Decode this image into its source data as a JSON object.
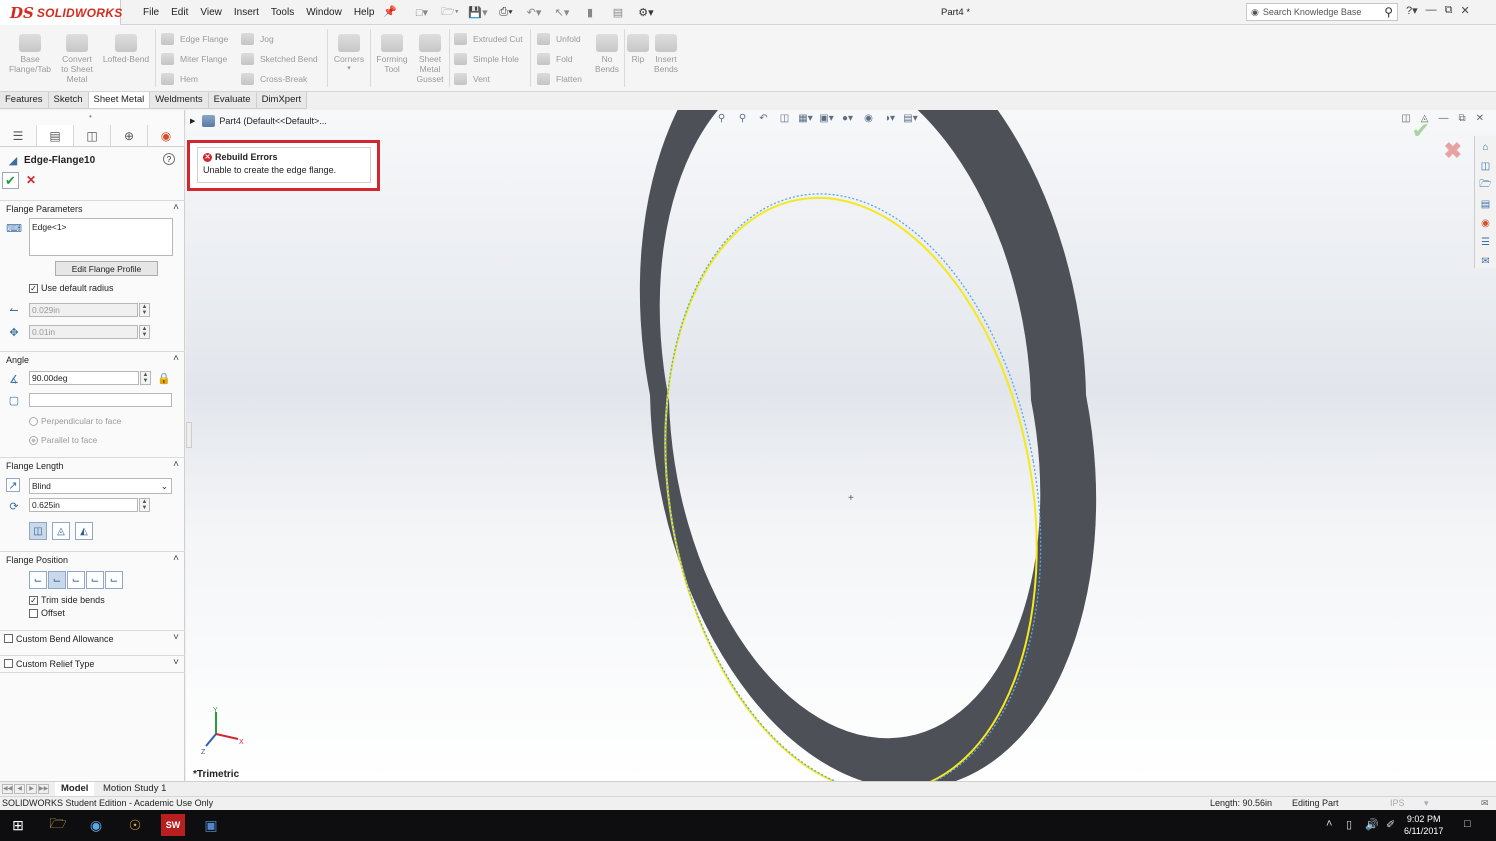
{
  "app": {
    "logo_ds": "DS",
    "logo_text": "SOLIDWORKS",
    "document_title": "Part4 *",
    "menu": [
      "File",
      "Edit",
      "View",
      "Insert",
      "Tools",
      "Window",
      "Help"
    ],
    "search_placeholder": "Search Knowledge Base"
  },
  "command_manager": {
    "big_buttons": [
      "Base Flange/Tab",
      "Convert to Sheet Metal",
      "Lofted-Bend",
      "Corners",
      "Forming Tool",
      "Sheet Metal Gusset",
      "No Bends",
      "Rip",
      "Insert Bends"
    ],
    "small_buttons": [
      "Edge Flange",
      "Miter Flange",
      "Hem",
      "Jog",
      "Sketched Bend",
      "Cross-Break",
      "Extruded Cut",
      "Simple Hole",
      "Vent",
      "Unfold",
      "Fold",
      "Flatten"
    ]
  },
  "tabs": [
    {
      "label": "Features",
      "active": false
    },
    {
      "label": "Sketch",
      "active": false
    },
    {
      "label": "Sheet Metal",
      "active": true
    },
    {
      "label": "Weldments",
      "active": false
    },
    {
      "label": "Evaluate",
      "active": false
    },
    {
      "label": "DimXpert",
      "active": false
    }
  ],
  "property_manager": {
    "title": "Edge-Flange10",
    "flange_parameters": {
      "header": "Flange Parameters",
      "selection": "Edge<1>",
      "edit_profile_button": "Edit Flange Profile",
      "use_default_radius_label": "Use default radius",
      "use_default_radius_checked": true,
      "bend_radius": "0.029in",
      "gap_distance": "0.01in"
    },
    "angle": {
      "header": "Angle",
      "value": "90.00deg",
      "reference_face": "",
      "perpendicular_label": "Perpendicular to face",
      "parallel_label": "Parallel to face"
    },
    "flange_length": {
      "header": "Flange Length",
      "end_condition": "Blind",
      "length": "0.625in"
    },
    "flange_position": {
      "header": "Flange Position",
      "trim_side_bends_label": "Trim side bends",
      "trim_side_bends_checked": true,
      "offset_label": "Offset",
      "offset_checked": false
    },
    "custom_bend_allowance": "Custom Bend Allowance",
    "custom_relief_type": "Custom Relief Type"
  },
  "graphics": {
    "tree_root": "Part4  (Default<<Default>...",
    "rebuild_title": "Rebuild Errors",
    "rebuild_message": "Unable to create the edge flange.",
    "view_orientation": "*Trimetric",
    "triad_x": "X",
    "triad_y": "Y",
    "triad_z": "Z",
    "colors": {
      "ring_fill": "#4e5058",
      "selected_edge": "#f5e81c",
      "preview_edge": "#5aa9e6",
      "error_border": "#d4262f"
    }
  },
  "bottom_tabs": [
    {
      "label": "Model",
      "active": true
    },
    {
      "label": "Motion Study 1",
      "active": false
    }
  ],
  "status": {
    "edition": "SOLIDWORKS Student Edition - Academic Use Only",
    "length": "Length: 90.56in",
    "mode": "Editing Part",
    "units": "IPS"
  },
  "taskbar": {
    "time": "9:02 PM",
    "date": "6/11/2017"
  }
}
